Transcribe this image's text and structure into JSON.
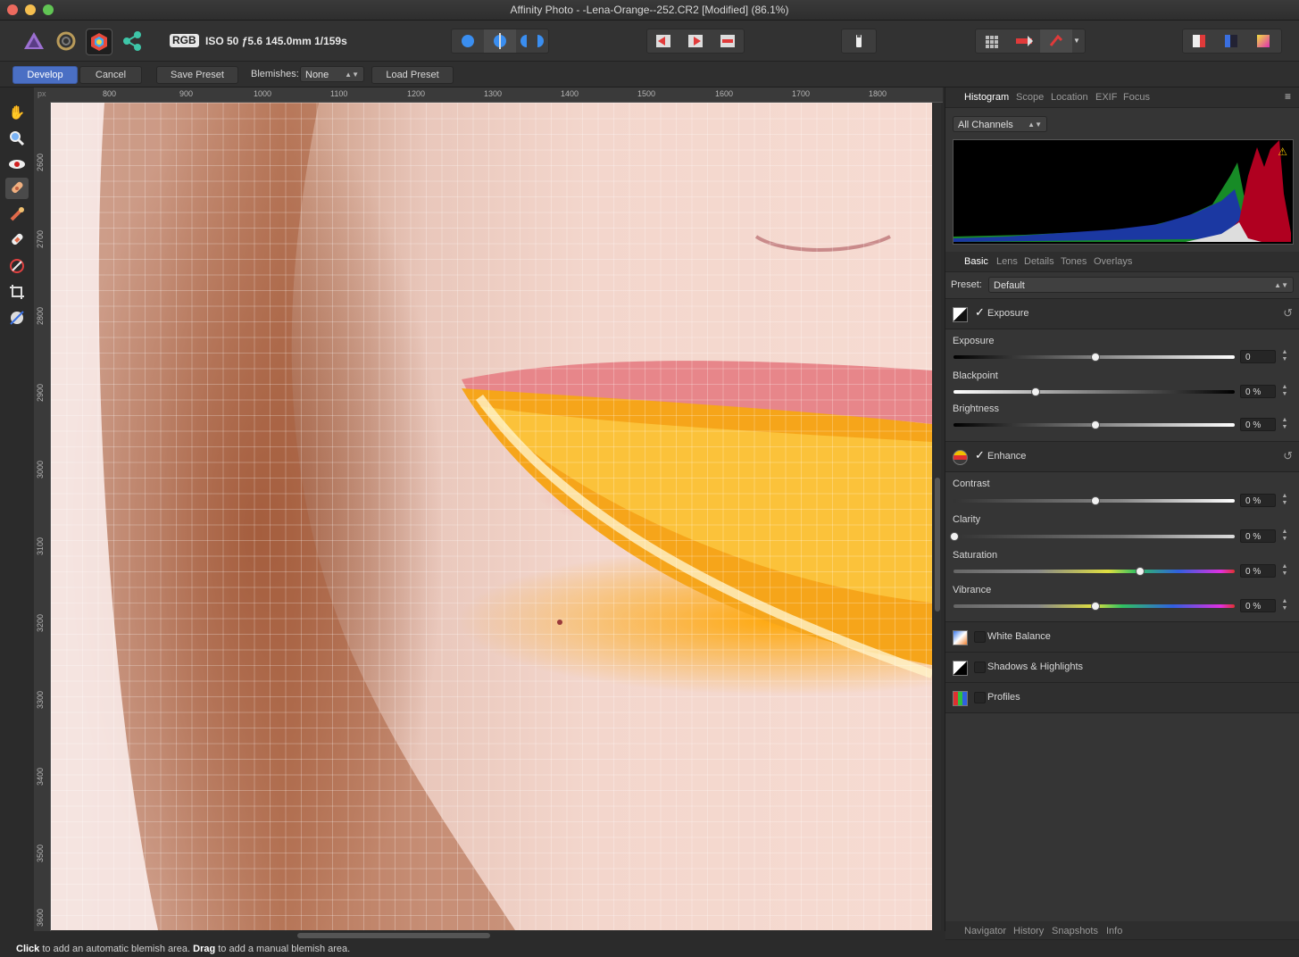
{
  "window": {
    "title": "Affinity Photo - -Lena-Orange--252.CR2 [Modified] (86.1%)"
  },
  "toolbar": {
    "color_mode": "RGB",
    "exif_summary": "ISO 50 ƒ5.6 145.0mm 1/159s",
    "personas": [
      "photo-persona-icon",
      "liquify-persona-icon",
      "develop-persona-icon",
      "export-persona-icon"
    ]
  },
  "context_bar": {
    "develop_label": "Develop",
    "cancel_label": "Cancel",
    "save_preset_label": "Save Preset",
    "blemishes_label": "Blemishes:",
    "blemishes_value": "None",
    "load_preset_label": "Load Preset"
  },
  "ruler": {
    "unit": "px",
    "h_ticks": [
      "800",
      "900",
      "1000",
      "1100",
      "1200",
      "1300",
      "1400",
      "1500",
      "1600",
      "1700",
      "1800"
    ],
    "v_ticks": [
      "2600",
      "2700",
      "2800",
      "2900",
      "3000",
      "3100",
      "3200",
      "3300",
      "3400",
      "3500",
      "3600"
    ]
  },
  "histogram_panel": {
    "tabs": [
      "Histogram",
      "Scope",
      "Location",
      "EXIF",
      "Focus"
    ],
    "active_tab": "Histogram",
    "channel_select": "All Channels"
  },
  "adjust_panel": {
    "tabs": [
      "Basic",
      "Lens",
      "Details",
      "Tones",
      "Overlays"
    ],
    "active_tab": "Basic",
    "preset_label": "Preset:",
    "preset_value": "Default",
    "exposure_section": {
      "title": "Exposure",
      "enabled": true,
      "sliders": [
        {
          "label": "Exposure",
          "value": "0",
          "level": 0.5
        },
        {
          "label": "Blackpoint",
          "value": "0 %",
          "level": 0.29
        },
        {
          "label": "Brightness",
          "value": "0 %",
          "level": 0.5
        }
      ]
    },
    "enhance_section": {
      "title": "Enhance",
      "enabled": true,
      "sliders": [
        {
          "label": "Contrast",
          "value": "0 %",
          "level": 0.5
        },
        {
          "label": "Clarity",
          "value": "0 %",
          "level": 0.0
        },
        {
          "label": "Saturation",
          "value": "0 %",
          "level": 0.66
        },
        {
          "label": "Vibrance",
          "value": "0 %",
          "level": 0.5
        }
      ]
    },
    "white_balance": {
      "title": "White Balance",
      "enabled": false
    },
    "shadows_highlights": {
      "title": "Shadows & Highlights",
      "enabled": false
    },
    "profiles": {
      "title": "Profiles",
      "enabled": false
    }
  },
  "bottom_tabs": [
    "Navigator",
    "History",
    "Snapshots",
    "Info"
  ],
  "status": {
    "click": "Click",
    "click_text": " to add an automatic blemish area. ",
    "drag": "Drag",
    "drag_text": " to add a manual blemish area."
  },
  "colors": {
    "accent": "#4a6fc4",
    "red_light": "#ed6a5e",
    "yellow_light": "#f5bf4f",
    "green_light": "#61c554"
  }
}
